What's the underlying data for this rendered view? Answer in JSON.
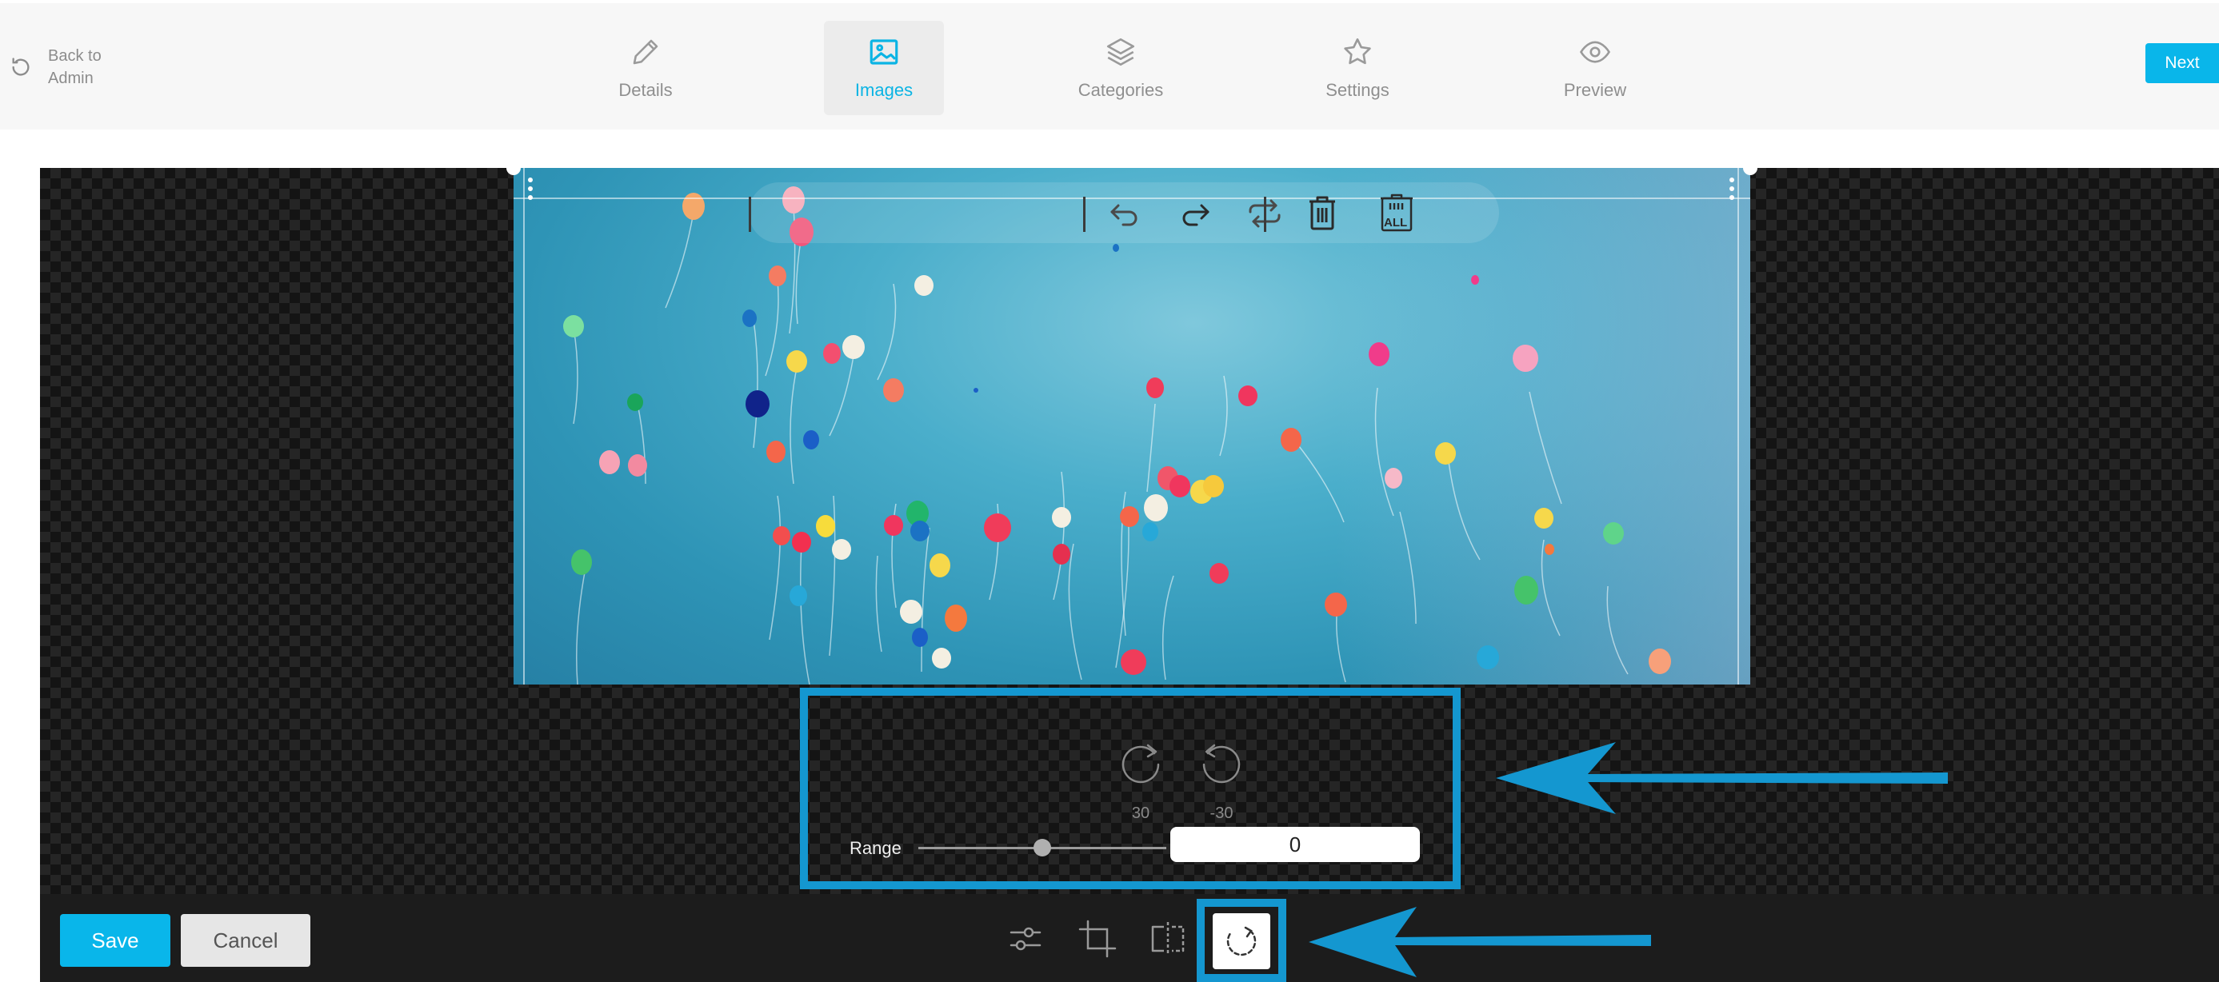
{
  "header": {
    "back_label": "Back to Admin",
    "steps": [
      {
        "label": "Details",
        "icon": "pencil-icon"
      },
      {
        "label": "Images",
        "icon": "image-icon",
        "active": true
      },
      {
        "label": "Categories",
        "icon": "layers-icon"
      },
      {
        "label": "Settings",
        "icon": "star-icon"
      },
      {
        "label": "Preview",
        "icon": "eye-icon"
      }
    ],
    "next_label": "Next"
  },
  "canvas_toolbar": {
    "icons": [
      "undo-icon",
      "redo-icon",
      "reset-icon",
      "delete-icon",
      "delete-all-icon"
    ],
    "delete_all_text": "ALL"
  },
  "rotate_panel": {
    "rotate_cw_value": "30",
    "rotate_ccw_value": "-30",
    "range_label": "Range",
    "range_value": "0",
    "range_fraction": 0.5
  },
  "footer": {
    "save_label": "Save",
    "cancel_label": "Cancel",
    "tools": [
      "adjust-icon",
      "crop-icon",
      "flip-icon",
      "rotate-icon"
    ],
    "active_tool": "rotate-icon"
  },
  "colors": {
    "accent": "#09b6ea",
    "highlight_border": "#1497d0",
    "canvas_bg": "#141414",
    "toolbar_bg": "#1c1c1c"
  }
}
